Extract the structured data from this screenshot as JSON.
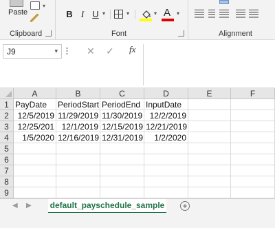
{
  "ribbon": {
    "clipboard": {
      "paste_label": "Paste",
      "group_label": "Clipboard"
    },
    "font": {
      "group_label": "Font",
      "bold": "B",
      "italic": "I",
      "underline": "U",
      "font_color_glyph": "A"
    },
    "alignment": {
      "group_label": "Alignment"
    },
    "colors": {
      "fill": "#ffff00",
      "font_color": "#e00000"
    }
  },
  "formula_bar": {
    "name_box": "J9",
    "cancel_glyph": "✕",
    "enter_glyph": "✓",
    "fx_label": "fx",
    "value": ""
  },
  "grid": {
    "columns": [
      "A",
      "B",
      "C",
      "D",
      "E",
      "F"
    ],
    "rows": [
      "1",
      "2",
      "3",
      "4",
      "5",
      "6",
      "7",
      "8",
      "9"
    ],
    "cells": [
      [
        "PayDate",
        "PeriodStart",
        "PeriodEnd",
        "InputDate",
        "",
        ""
      ],
      [
        "12/5/2019",
        "11/29/2019",
        "11/30/2019",
        "12/2/2019",
        "",
        ""
      ],
      [
        "12/25/201",
        "12/1/2019",
        "12/15/2019",
        "12/21/2019",
        "",
        ""
      ],
      [
        "1/5/2020",
        "12/16/2019",
        "12/31/2019",
        "1/2/2020",
        "",
        ""
      ],
      [
        "",
        "",
        "",
        "",
        "",
        ""
      ],
      [
        "",
        "",
        "",
        "",
        "",
        ""
      ],
      [
        "",
        "",
        "",
        "",
        "",
        ""
      ],
      [
        "",
        "",
        "",
        "",
        "",
        ""
      ],
      [
        "",
        "",
        "",
        "",
        "",
        ""
      ]
    ]
  },
  "sheet_tabs": {
    "active": "default_payschedule_sample",
    "add_glyph": "+",
    "accent": "#217346"
  }
}
